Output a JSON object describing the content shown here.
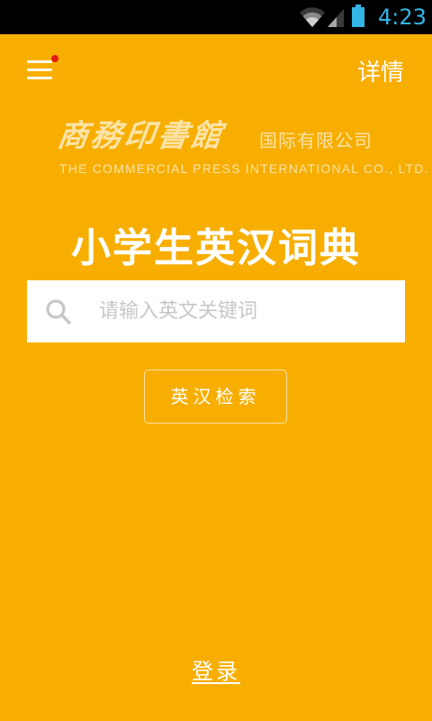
{
  "status_bar": {
    "time": "4:23",
    "icons": [
      "wifi-icon",
      "signal-icon",
      "battery-icon"
    ],
    "clock_color": "#33B5E5"
  },
  "header": {
    "menu_icon": "hamburger-menu-icon",
    "notification_dot_color": "#E41B14",
    "detail_label": "详情"
  },
  "logo": {
    "calligraphy": "商務印書館",
    "name_cn": "国际有限公司",
    "name_en": "THE COMMERCIAL PRESS INTERNATIONAL CO., LTD."
  },
  "app_title": "小学生英汉词典",
  "search": {
    "icon": "search-icon",
    "placeholder": "请输入英文关键词",
    "value": ""
  },
  "search_button_label": "英汉检索",
  "login_label": "登录",
  "colors": {
    "background": "#F7AE00",
    "text": "#FFFFFF",
    "logo_text": "#FCE3A6",
    "placeholder": "#C7C7C7"
  }
}
